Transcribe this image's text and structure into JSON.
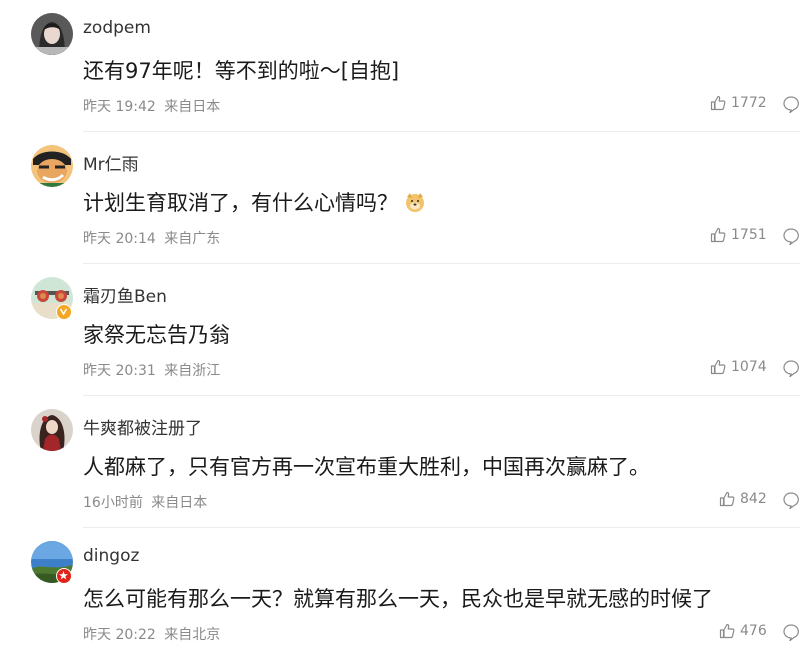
{
  "comments": [
    {
      "username": "zodpem",
      "text": "还有97年呢！等不到的啦～[自抱]",
      "time": "昨天 19:42",
      "location": "来自日本",
      "likes": "1772",
      "avatar_icon": "girl-avatar",
      "badge": null
    },
    {
      "username": "Mr仁雨",
      "text": "计划生育取消了，有什么心情吗？",
      "emoji": "doge-emoji",
      "time": "昨天 20:14",
      "location": "来自广东",
      "likes": "1751",
      "avatar_icon": "cartoon-face-avatar",
      "badge": null
    },
    {
      "username": "霜刃鱼Ben",
      "text": "家祭无忘告乃翁",
      "time": "昨天 20:31",
      "location": "来自浙江",
      "likes": "1074",
      "avatar_icon": "sunglasses-avatar",
      "badge": "verified-v-badge",
      "badge_color": "#f5a623"
    },
    {
      "username": "牛爽都被注册了",
      "text": "人都麻了，只有官方再一次宣布重大胜利，中国再次赢麻了。",
      "time": "16小时前",
      "location": "来自日本",
      "likes": "842",
      "avatar_icon": "anime-character-avatar",
      "badge": null
    },
    {
      "username": "dingoz",
      "text": "怎么可能有那么一天？就算有那么一天，民众也是早就无感的时候了",
      "time": "昨天 20:22",
      "location": "来自北京",
      "likes": "476",
      "avatar_icon": "landscape-avatar",
      "badge": "red-star-badge",
      "badge_color": "#e2231a"
    }
  ],
  "colors": {
    "meta_gray": "#8a8a8a",
    "divider": "#ececec",
    "text": "#1a1a1a"
  }
}
